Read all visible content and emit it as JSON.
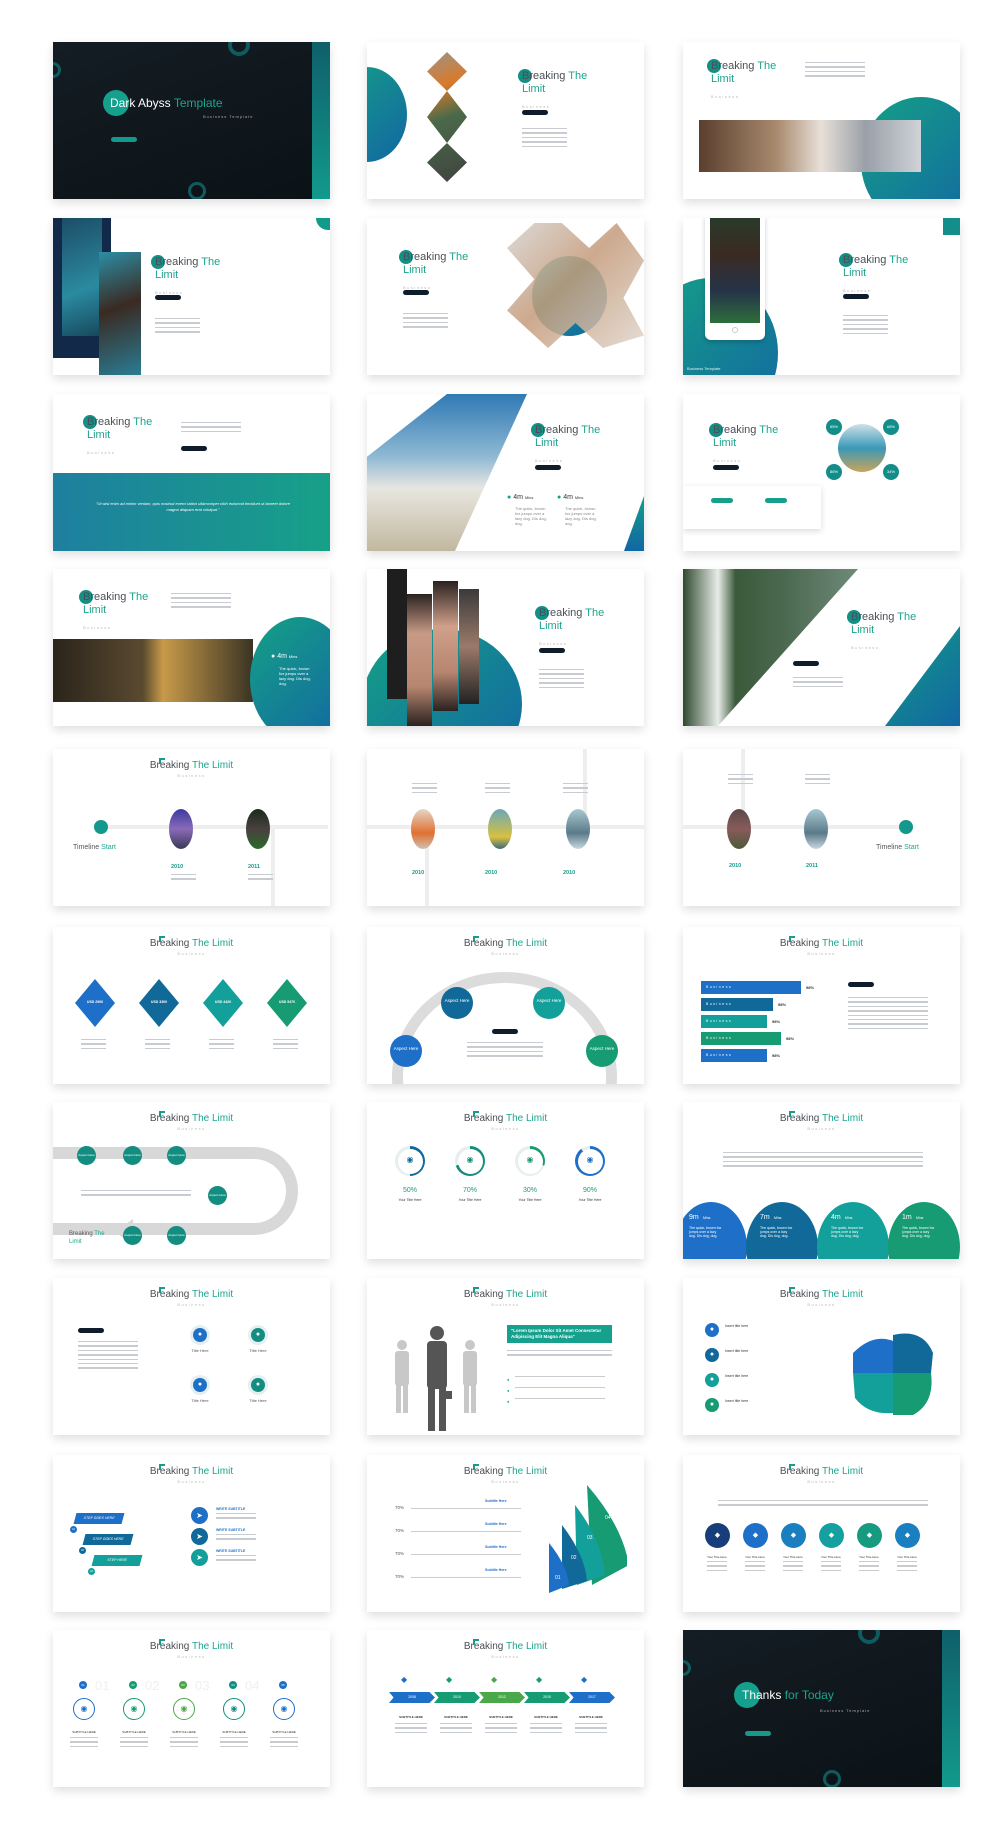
{
  "colors": {
    "teal": "#1ba58e",
    "blue": "#1e6fc8",
    "deep_blue": "#11699a",
    "green": "#179b72",
    "navy": "#0f1c2b",
    "dark_bg": "#111a20"
  },
  "common": {
    "title_word1": "Breaking",
    "title_word2": "The",
    "title_word3": "Limit",
    "title_accent": "The Limit",
    "subtitle": "Business"
  },
  "cover": {
    "title_white": "Dark Abyss",
    "title_accent": "Template",
    "subtitle": "Business Template"
  },
  "closing": {
    "title_white": "Thanks",
    "title_accent": "for Today",
    "subtitle": "Business Template"
  },
  "phone_slide": {
    "footer": "Business Template"
  },
  "quote_slide": {
    "quote": "\"Ut wisi enim ad minim veniam, quis nostrud exerci tation ullamcorper nibh euismod tincidunt ut laoreet dolore magna aliquam erat volutpat.\""
  },
  "stats_4m": {
    "value": "4m",
    "unit": "Mins",
    "desc": "The quick, brown fox jumps over a lazy dog. Dis dog, dog."
  },
  "percent_circles": [
    "65%",
    "68%",
    "86%",
    "34%"
  ],
  "timeline": {
    "start_word": "Timeline",
    "start_accent": "Start",
    "years_a": [
      "2010",
      "2011"
    ],
    "years_b": [
      "2010",
      "2010",
      "2010"
    ]
  },
  "prices": [
    "USD 2900",
    "USD 3300",
    "USD 4420",
    "USD 5470"
  ],
  "aspect": "Aspect Here",
  "bars": {
    "label": "Business",
    "values": [
      "98%",
      "98%",
      "98%",
      "98%",
      "98%"
    ],
    "fills": [
      1.0,
      0.72,
      0.66,
      0.8,
      0.66
    ]
  },
  "progress": [
    {
      "pct": "50%",
      "value": 0.5,
      "title": "Your Title Here",
      "icon": "lock-icon"
    },
    {
      "pct": "70%",
      "value": 0.7,
      "title": "Your Title Here",
      "icon": "rss-icon"
    },
    {
      "pct": "30%",
      "value": 0.3,
      "title": "Your Title Here",
      "icon": "document-icon"
    },
    {
      "pct": "90%",
      "value": 0.9,
      "title": "Your Title Here",
      "icon": "send-icon"
    }
  ],
  "durations": [
    {
      "value": "9m",
      "unit": "Mins"
    },
    {
      "value": "7m",
      "unit": "Mins"
    },
    {
      "value": "4m",
      "unit": "Mins"
    },
    {
      "value": "1m",
      "unit": "Mins"
    }
  ],
  "duration_desc": "The quick, brown fox jumps over a lazy dog. Dis dog, dog.",
  "social": {
    "title": "Title Here",
    "icons": [
      "twitter-icon",
      "instagram-icon",
      "facebook-icon",
      "tumblr-icon"
    ]
  },
  "business_quote": "\"Lorem Ipsum Dolor Sit Amet Consectetur Adipiscing Elit Magna Aliqua\"",
  "insert_title": "Insert title here",
  "steps": {
    "labels": [
      "STEP GOES HERE",
      "STEP GOES HERE",
      "STEP HERE"
    ],
    "numbers": [
      "01",
      "02",
      "03"
    ],
    "subtitle": "WRITE SUBTITLE"
  },
  "funnel": {
    "pct": [
      "70%",
      "70%",
      "70%",
      "70%"
    ],
    "subtitle": "Subtitle Here",
    "numbers": [
      "01",
      "02",
      "03",
      "04"
    ]
  },
  "hex_title": "Your Title Here",
  "numbered": {
    "numbers": [
      "01",
      "02",
      "03",
      "04",
      "05"
    ],
    "bg_numbers": [
      "01",
      "02",
      "03",
      "04"
    ],
    "subtitle": "SUBTITLE HERE"
  },
  "arrow_timeline": {
    "years": [
      "2008",
      "2010",
      "2012",
      "2015",
      "2017"
    ],
    "subtitle": "SUBTITLE HERE"
  }
}
